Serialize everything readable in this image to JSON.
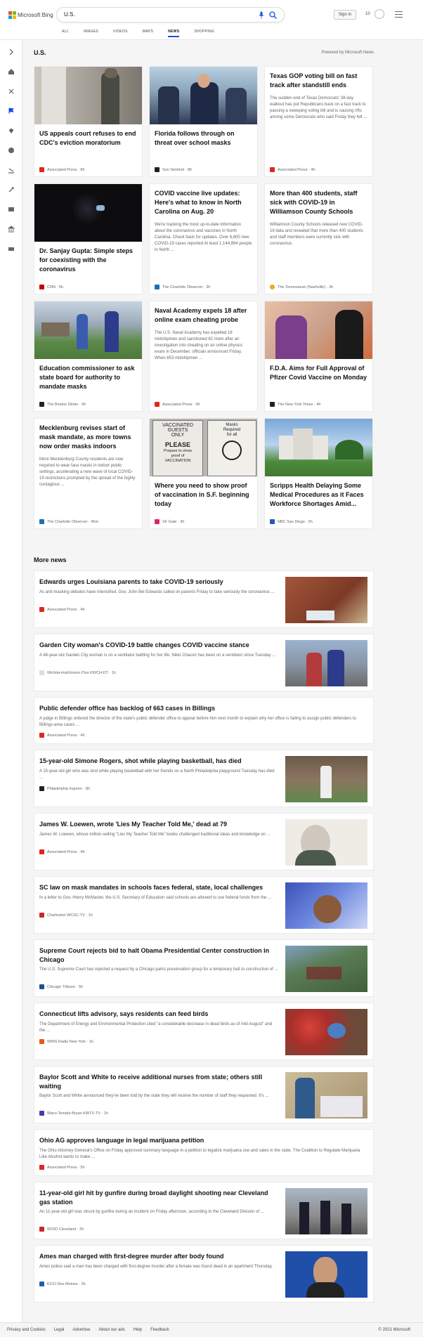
{
  "header": {
    "brand": "Microsoft Bing",
    "search_query": "U.S.",
    "signin_label": "Sign in",
    "rewards_count": "10"
  },
  "nav": [
    "ALL",
    "IMAGES",
    "VIDEOS",
    "MAPS",
    "NEWS",
    "SHOPPING"
  ],
  "nav_active": "NEWS",
  "section": {
    "title": "U.S.",
    "powered_by": "Powered by Microsoft News"
  },
  "cards": [
    {
      "title": "US appeals court refuses to end CDC's eviction moratorium",
      "snippet": "",
      "source": "Associated Press",
      "time": "8h"
    },
    {
      "title": "Florida follows through on threat over school masks",
      "snippet": "",
      "source": "Sun Sentinel",
      "time": "8h"
    },
    {
      "title": "Texas GOP voting bill on fast track after standstill ends",
      "snippet": "The sudden end of Texas Democrats' 38-day walkout has put Republicans back on a fast track to passing a sweeping voting bill and is causing rifts among some Democrats who said Friday they felt ...",
      "source": "Associated Press",
      "time": "4h"
    },
    {
      "title": "Dr. Sanjay Gupta: Simple steps for coexisting with the coronavirus",
      "snippet": "",
      "source": "CNN",
      "time": "5h"
    },
    {
      "title": "COVID vaccine live updates: Here's what to know in North Carolina on Aug. 20",
      "snippet": "We're tracking the most up-to-date information about the coronavirus and vaccines in North Carolina. Check back for updates. Over 6,600 new COVID-19 cases reported At least 1,144,894 people in North ...",
      "source": "The Charlotte Observer",
      "time": "3h"
    },
    {
      "title": "More than 400 students, staff sick with COVID-19 in Williamson County Schools",
      "snippet": "Williamson County Schools released new COVID-19 data and revealed that more than 400 students and staff members were currently sick with coronavirus.",
      "source": "The Tennessean (Nashville)",
      "time": "3h"
    },
    {
      "title": "Education commissioner to ask state board for authority to mandate masks",
      "snippet": "",
      "source": "The Boston Globe",
      "time": "6h"
    },
    {
      "title": "Naval Academy expels 18 after online exam cheating probe",
      "snippet": "The U.S. Naval Academy has expelled 18 midshipmen and sanctioned 82 more after an investigation into cheating on an online physics exam in December, officials announced Friday. When 653 midshipmen ...",
      "source": "Associated Press",
      "time": "9h"
    },
    {
      "title": "F.D.A. Aims for Full Approval of Pfizer Covid Vaccine on Monday",
      "snippet": "",
      "source": "The New York Times",
      "time": "4h"
    },
    {
      "title": "Mecklenburg revises start of mask mandate, as more towns now order masks indoors",
      "snippet": "More Mecklenburg County residents are now required to wear face masks in indoor public settings, accelerating a new wave of local COVID-19 restrictions prompted by the spread of the highly contagious ...",
      "source": "The Charlotte Observer",
      "time": "45m"
    },
    {
      "title": "Where you need to show proof of vaccination in S.F. beginning today",
      "snippet": "",
      "source": "SF Gate",
      "time": "3h"
    },
    {
      "title": "Scripps Health Delaying Some Medical Procedures as it Faces Workforce Shortages Amid...",
      "snippet": "",
      "source": "NBC San Diego",
      "time": "5h"
    }
  ],
  "card_image_text": {
    "sign_line1": "VACCINATED",
    "sign_line2": "GUESTS",
    "sign_line3": "ONLY",
    "sign_line4": "PLEASE",
    "sign_line5": "Prepare to show",
    "sign_line6": "proof of",
    "sign_line7": "VACCINATION",
    "sign2_line1": "Masks",
    "sign2_line2": "Required",
    "sign2_line3": "for all"
  },
  "more_news": {
    "title": "More news",
    "items": [
      {
        "title": "Edwards urges Louisiana parents to take COVID-19 seriously",
        "snippet": "As anti-masking debates have intensified, Gov. John Bel Edwards called on parents Friday to take seriously the coronavirus ...",
        "source": "Associated Press",
        "time": "4h"
      },
      {
        "title": "Garden City woman's COVID-19 battle changes COVID vaccine stance",
        "snippet": "A 48-year-old Garden City woman is on a ventilator battling for her life. Nikki Chacon has been on a ventilator since Tuesday ...",
        "source": "Wichita-Hutchinson Plus KWCH-DT",
        "time": "1h"
      },
      {
        "title": "Public defender office has backlog of 663 cases in Billings",
        "snippet": "A judge in Billings ordered the director of the state's public defender office to appear before him next month to explain why her office is failing to assign public defenders to Billings-area cases ...",
        "source": "Associated Press",
        "time": "4h"
      },
      {
        "title": "15-year-old Simone Rogers, shot while playing basketball, has died",
        "snippet": "A 15-year-old girl who was shot while playing basketball with her friends on a North Philadelphia playground Tuesday has died ...",
        "source": "Philadelphia Inquirer",
        "time": "8h"
      },
      {
        "title": "James W. Loewen, wrote 'Lies My Teacher Told Me,' dead at 79",
        "snippet": "James W. Loewen, whose million-selling \"Lies My Teacher Told Me\" books challenged traditional ideas and knowledge on ...",
        "source": "Associated Press",
        "time": "4h"
      },
      {
        "title": "SC law on mask mandates in schools faces federal, state, local challenges",
        "snippet": "In a letter to Gov. Henry McMaster, the U.S. Secretary of Education said schools are allowed to use federal funds from the ...",
        "source": "Charleston WCSC-TV",
        "time": "1h"
      },
      {
        "title": "Supreme Court rejects bid to halt Obama Presidential Center construction in Chicago",
        "snippet": "The U.S. Supreme Court has rejected a request by a Chicago parks preservation group for a temporary halt to construction of ...",
        "source": "Chicago Tribune",
        "time": "5h"
      },
      {
        "title": "Connecticut lifts advisory, says residents can feed birds",
        "snippet": "The Department of Energy and Environmental Protection cited \"a considerable decrease in dead birds as of mid-August\" and the ...",
        "source": "WINS Radio New York",
        "time": "1h"
      },
      {
        "title": "Baylor Scott and White to receive additional nurses from state; others still waiting",
        "snippet": "Baylor Scott and White announced they've been told by the state they will receive the number of staff they requested. It's ...",
        "source": "Waco-Temple-Bryan KWTX-TV",
        "time": "1h"
      },
      {
        "title": "Ohio AG approves language in legal marijuana petition",
        "snippet": "The Ohio Attorney General's Office on Friday approved summary language in a petition to legalize marijuana use and sales in the state. The Coalition to Regulate Marijuana Like Alcohol wants to make ...",
        "source": "Associated Press",
        "time": "5h"
      },
      {
        "title": "11-year-old girl hit by gunfire during broad daylight shooting near Cleveland gas station",
        "snippet": "An 11-year-old girl was struck by gunfire during an incident on Friday afternoon, according to the Cleveland Division of ...",
        "source": "WOIO Cleveland",
        "time": "2h"
      },
      {
        "title": "Ames man charged with first-degree murder after body found",
        "snippet": "Ames police said a man has been charged with first-degree murder after a female was found dead in an apartment Thursday.",
        "source": "KCCI Des Moines",
        "time": "2h"
      }
    ]
  },
  "footer": {
    "links": [
      "Privacy and Cookies",
      "Legal",
      "Advertise",
      "About our ads",
      "Help",
      "Feedback"
    ],
    "copyright": "© 2021 Microsoft"
  }
}
